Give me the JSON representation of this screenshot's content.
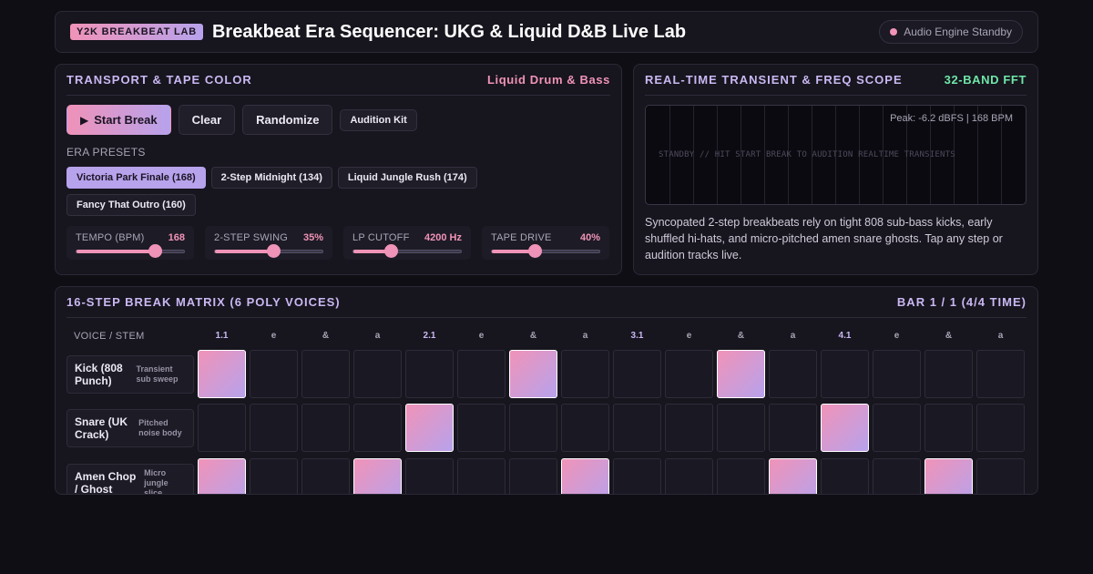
{
  "header": {
    "badge": "Y2K BREAKBEAT LAB",
    "title": "Breakbeat Era Sequencer: UKG & Liquid D&B Live Lab",
    "status": "Audio Engine Standby"
  },
  "transport": {
    "title": "TRANSPORT & TAPE COLOR",
    "tag": "Liquid Drum & Bass",
    "tag_color": "#f093b8",
    "buttons": {
      "start": "Start Break",
      "clear": "Clear",
      "randomize": "Randomize",
      "audition": "Audition Kit"
    },
    "presets_label": "ERA PRESETS",
    "presets": [
      {
        "label": "Victoria Park Finale (168)",
        "active": true
      },
      {
        "label": "2-Step Midnight (134)",
        "active": false
      },
      {
        "label": "Liquid Jungle Rush (174)",
        "active": false
      },
      {
        "label": "Fancy That Outro (160)",
        "active": false
      }
    ],
    "sliders": [
      {
        "label": "TEMPO (BPM)",
        "value": "168",
        "level": 0.73
      },
      {
        "label": "2-STEP SWING",
        "value": "35%",
        "level": 0.54
      },
      {
        "label": "LP CUTOFF",
        "value": "4200 Hz",
        "level": 0.35
      },
      {
        "label": "TAPE DRIVE",
        "value": "40%",
        "level": 0.4
      }
    ]
  },
  "scope": {
    "title": "REAL-TIME TRANSIENT & FREQ SCOPE",
    "tag": "32-BAND FFT",
    "tag_color": "#6ee7a8",
    "peak": "Peak: -6.2 dBFS | 168 BPM",
    "message": "STANDBY // HIT START BREAK TO AUDITION REALTIME TRANSIENTS",
    "description": "Syncopated 2-step breakbeats rely on tight 808 sub-bass kicks, early shuffled hi-hats, and micro-pitched amen snare ghosts. Tap any step or audition tracks live."
  },
  "matrix": {
    "title": "16-STEP BREAK MATRIX (6 POLY VOICES)",
    "bar": "BAR 1 / 1 (4/4 TIME)",
    "voice_header": "VOICE / STEM",
    "steps": [
      "1.1",
      "e",
      "&",
      "a",
      "2.1",
      "e",
      "&",
      "a",
      "3.1",
      "e",
      "&",
      "a",
      "4.1",
      "e",
      "&",
      "a"
    ],
    "voices": [
      {
        "name": "Kick (808 Punch)",
        "sub": "Transient sub sweep",
        "pattern": [
          1,
          0,
          0,
          0,
          0,
          0,
          1,
          0,
          0,
          0,
          1,
          0,
          0,
          0,
          0,
          0
        ]
      },
      {
        "name": "Snare (UK Crack)",
        "sub": "Pitched noise body",
        "pattern": [
          0,
          0,
          0,
          0,
          1,
          0,
          0,
          0,
          0,
          0,
          0,
          0,
          1,
          0,
          0,
          0
        ]
      },
      {
        "name": "Amen Chop / Ghost",
        "sub": "Micro jungle slice",
        "pattern": [
          1,
          0,
          0,
          1,
          0,
          0,
          0,
          1,
          0,
          0,
          0,
          1,
          0,
          0,
          1,
          0
        ]
      }
    ]
  }
}
